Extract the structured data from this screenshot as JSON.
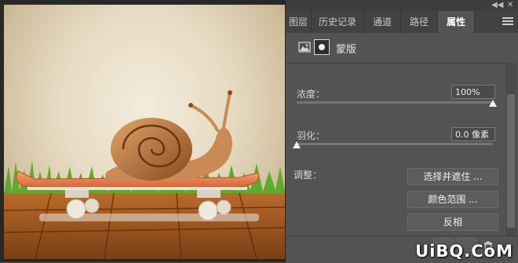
{
  "panel": {
    "tabs": [
      {
        "label": "图层",
        "active": false
      },
      {
        "label": "历史记录",
        "active": false
      },
      {
        "label": "通道",
        "active": false
      },
      {
        "label": "路径",
        "active": false
      },
      {
        "label": "属性",
        "active": true
      }
    ],
    "mask_label": "蒙版",
    "density": {
      "label": "浓度：",
      "value": "100%",
      "level": 1.0
    },
    "feather": {
      "label": "羽化：",
      "value": "0.0 像素",
      "level": 0.0
    },
    "adjust_label": "调整：",
    "buttons": {
      "select_mask": "选择并遮住 ...",
      "color_range": "颜色范围 ...",
      "invert": "反相"
    }
  },
  "icons": {
    "collapse": "collapse-double-arrow-icon",
    "menu": "panel-menu-icon",
    "pixel_mask": "pixel-mask-icon",
    "vector_mask": "mask-icon",
    "trash": "trash-icon"
  },
  "watermark": "UiBQ.CoM",
  "colors": {
    "panel_bg": "#535353",
    "tab_bar": "#424242",
    "canvas_bg": "#282828"
  }
}
